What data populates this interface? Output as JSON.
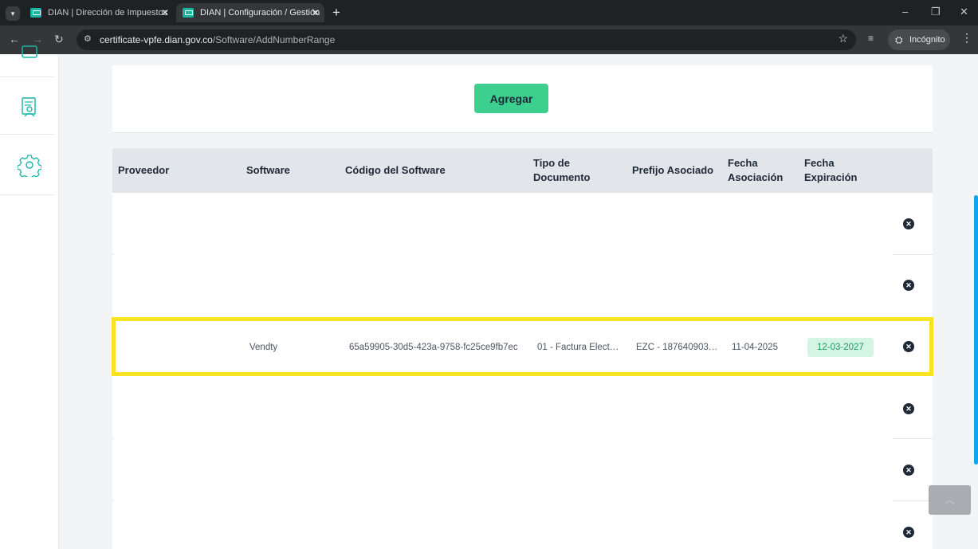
{
  "browser": {
    "tabs": [
      {
        "title": "DIAN | Dirección de Impuestos",
        "active": false
      },
      {
        "title": "DIAN | Configuración / Gestión",
        "active": true
      }
    ],
    "url_host": "certificate-vpfe.dian.gov.co",
    "url_path": "/Software/AddNumberRange",
    "incognito_label": "Incógnito"
  },
  "sidebar": {
    "icons": [
      "document-icon",
      "person-document-icon",
      "gear-icon"
    ]
  },
  "form": {
    "add_button_label": "Agregar"
  },
  "table": {
    "columns": [
      "Proveedor",
      "Software",
      "Código del Software",
      "Tipo de Documento",
      "Prefijo Asociado",
      "Fecha Asociación",
      "Fecha Expiración"
    ],
    "highlighted_row": {
      "proveedor": "",
      "software": "Vendty",
      "codigo": "65a59905-30d5-423a-9758-fc25ce9fb7ec",
      "tipo_documento": "01 - Factura Elect…",
      "prefijo": "EZC - 187640903…",
      "fecha_asociacion": "11-04-2025",
      "fecha_expiracion": "12-03-2027"
    }
  },
  "colors": {
    "accent_green": "#3ccf8e",
    "badge_green": "#d4f5e4",
    "highlight_yellow": "#f7e321",
    "scroll_blue": "#0ea5e9"
  }
}
